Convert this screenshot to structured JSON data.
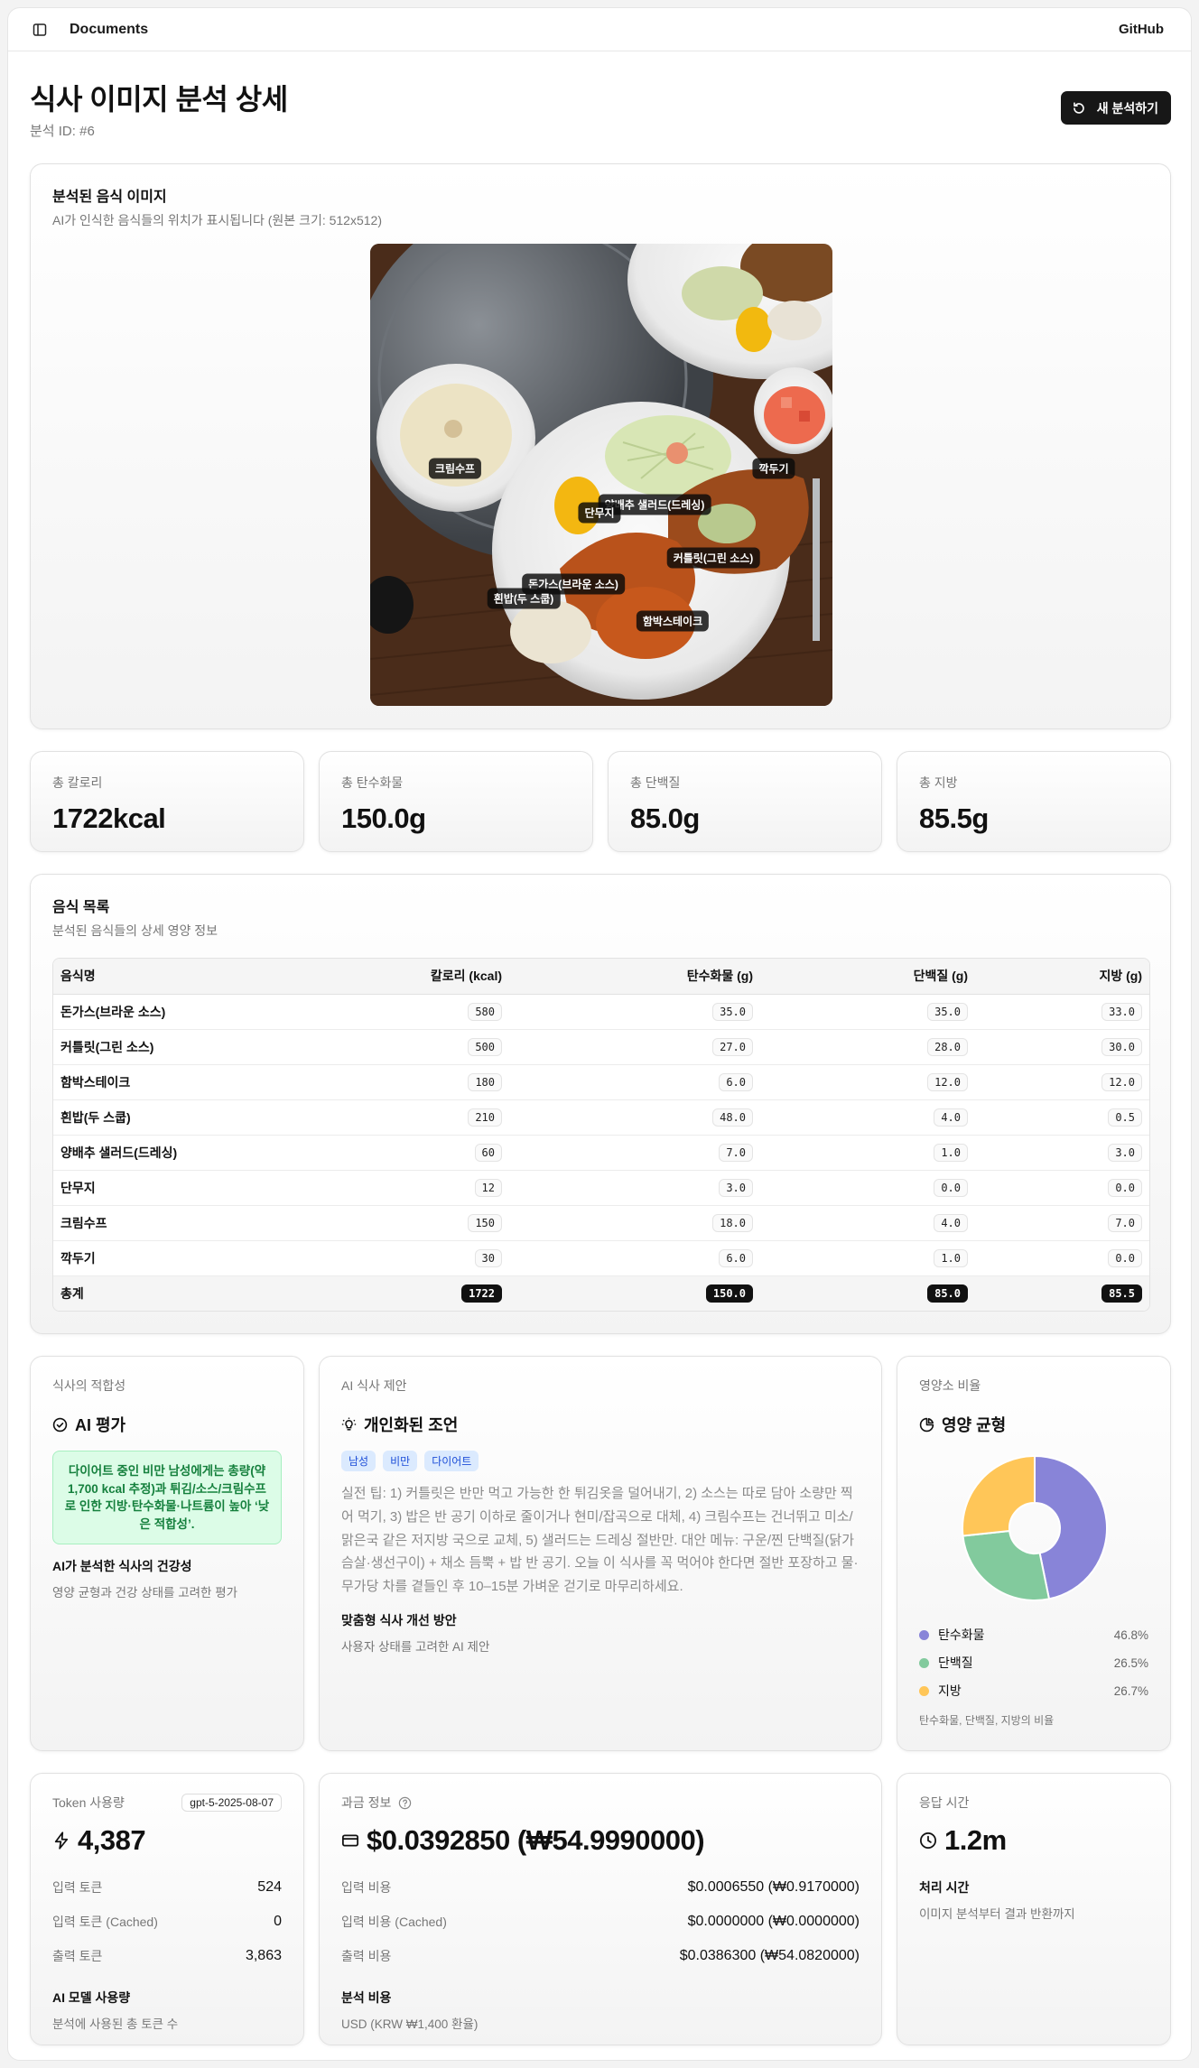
{
  "topbar": {
    "title": "Documents",
    "github": "GitHub"
  },
  "page": {
    "title": "식사 이미지 분석 상세",
    "analysis_id": "분석 ID: #6",
    "new_button": "새 분석하기"
  },
  "image_card": {
    "title": "분석된 음식 이미지",
    "desc": "AI가 인식한 음식들의 위치가 표시됩니다  (원본 크기: 512x512)",
    "tags": {
      "cream_soup": "크림수프",
      "kkakdugi": "깍두기",
      "cabbage_salad": "양배추 샐러드(드레싱)",
      "danmuji": "단무지",
      "cutlet": "커틀릿(그린 소스)",
      "donkatsu": "돈가스(브라운 소스)",
      "rice": "흰밥(두 스쿱)",
      "hamburg": "함박스테이크"
    }
  },
  "stats": {
    "calories": {
      "label": "총 칼로리",
      "value": "1722kcal"
    },
    "carbs": {
      "label": "총 탄수화물",
      "value": "150.0g"
    },
    "protein": {
      "label": "총 단백질",
      "value": "85.0g"
    },
    "fat": {
      "label": "총 지방",
      "value": "85.5g"
    }
  },
  "food_list": {
    "title": "음식 목록",
    "desc": "분석된 음식들의 상세 영양 정보",
    "headers": {
      "name": "음식명",
      "kcal": "칼로리 (kcal)",
      "carb": "탄수화물 (g)",
      "protein": "단백질 (g)",
      "fat": "지방 (g)"
    },
    "rows": [
      {
        "name": "돈가스(브라운 소스)",
        "kcal": "580",
        "carb": "35.0",
        "protein": "35.0",
        "fat": "33.0"
      },
      {
        "name": "커틀릿(그린 소스)",
        "kcal": "500",
        "carb": "27.0",
        "protein": "28.0",
        "fat": "30.0"
      },
      {
        "name": "함박스테이크",
        "kcal": "180",
        "carb": "6.0",
        "protein": "12.0",
        "fat": "12.0"
      },
      {
        "name": "흰밥(두 스쿱)",
        "kcal": "210",
        "carb": "48.0",
        "protein": "4.0",
        "fat": "0.5"
      },
      {
        "name": "양배추 샐러드(드레싱)",
        "kcal": "60",
        "carb": "7.0",
        "protein": "1.0",
        "fat": "3.0"
      },
      {
        "name": "단무지",
        "kcal": "12",
        "carb": "3.0",
        "protein": "0.0",
        "fat": "0.0"
      },
      {
        "name": "크림수프",
        "kcal": "150",
        "carb": "18.0",
        "protein": "4.0",
        "fat": "7.0"
      },
      {
        "name": "깍두기",
        "kcal": "30",
        "carb": "6.0",
        "protein": "1.0",
        "fat": "0.0"
      }
    ],
    "total": {
      "name": "총계",
      "kcal": "1722",
      "carb": "150.0",
      "protein": "85.0",
      "fat": "85.5"
    }
  },
  "suitability": {
    "label": "식사의 적합성",
    "heading": "AI 평가",
    "alert": "다이어트 중인 비만 남성에게는 총량(약 1,700 kcal 추정)과 튀김/소스/크림수프로 인한 지방·탄수화물·나트륨이 높아 ‘낮은 적합성’.",
    "sub_title": "AI가 분석한 식사의 건강성",
    "sub_desc": "영양 균형과 건강 상태를 고려한 평가"
  },
  "suggestion": {
    "label": "AI 식사 제안",
    "heading": "개인화된 조언",
    "badges": [
      "남성",
      "비만",
      "다이어트"
    ],
    "text": "실전 팁: 1) 커틀릿은 반만 먹고 가능한 한 튀김옷을 덜어내기, 2) 소스는 따로 담아 소량만 찍어 먹기, 3) 밥은 반 공기 이하로 줄이거나 현미/잡곡으로 대체, 4) 크림수프는 건너뛰고 미소/맑은국 같은 저지방 국으로 교체, 5) 샐러드는 드레싱 절반만. 대안 메뉴: 구운/찐 단백질(닭가슴살·생선구이) + 채소 듬뿍 + 밥 반 공기. 오늘 이 식사를 꼭 먹어야 한다면 절반 포장하고 물·무가당 차를 곁들인 후 10–15분 가벼운 걷기로 마무리하세요.",
    "sub_title": "맞춤형 식사 개선 방안",
    "sub_desc": "사용자 상태를 고려한 AI 제안"
  },
  "nutrient_ratio": {
    "label": "영양소 비율",
    "heading": "영양 균형",
    "footer": "탄수화물, 단백질, 지방의 비율"
  },
  "chart_data": {
    "type": "pie",
    "categories": [
      "탄수화물",
      "단백질",
      "지방"
    ],
    "values": [
      46.8,
      26.5,
      26.7
    ],
    "value_labels": [
      "46.8%",
      "26.5%",
      "26.7%"
    ],
    "colors": [
      "#8884d8",
      "#82ca9d",
      "#ffc658"
    ],
    "donut": true
  },
  "tokens": {
    "label": "Token 사용량",
    "model": "gpt-5-2025-08-07",
    "total": "4,387",
    "input_label": "입력 토큰",
    "input": "524",
    "cached_label": "입력 토큰 (Cached)",
    "cached": "0",
    "output_label": "출력 토큰",
    "output": "3,863",
    "sub_title": "AI 모델 사용량",
    "sub_desc": "분석에 사용된 총 토큰 수"
  },
  "cost": {
    "label": "과금 정보",
    "total": "$0.0392850 (₩54.9990000)",
    "input_label": "입력 비용",
    "input": "$0.0006550 (₩0.9170000)",
    "cached_label": "입력 비용 (Cached)",
    "cached": "$0.0000000 (₩0.0000000)",
    "output_label": "출력 비용",
    "output": "$0.0386300 (₩54.0820000)",
    "sub_title": "분석 비용",
    "sub_desc": "USD (KRW ₩1,400 환율)"
  },
  "response": {
    "label": "응답 시간",
    "value": "1.2m",
    "sub_title": "처리 시간",
    "sub_desc": "이미지 분석부터 결과 반환까지"
  }
}
